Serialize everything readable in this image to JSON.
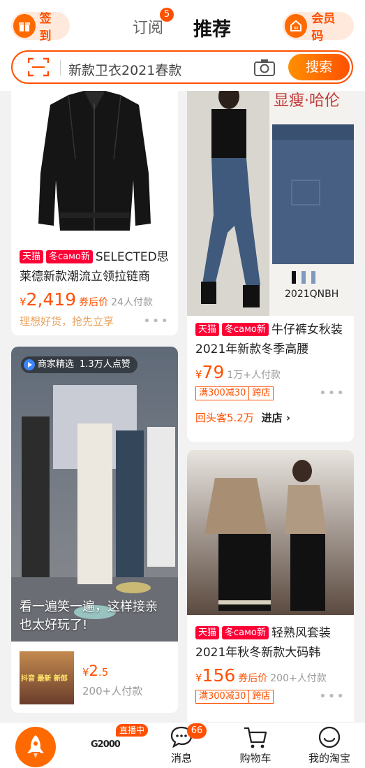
{
  "header": {
    "signin_label": "签到",
    "tab_subscribe": "订阅",
    "tab_subscribe_badge": "5",
    "tab_recommend": "推荐",
    "member_label": "会员码"
  },
  "search": {
    "query": "新款卫衣2021春款",
    "button_label": "搜索"
  },
  "feed": {
    "jacket": {
      "tag1": "天猫",
      "tag2": "冬само新",
      "title": "SELECTED思莱德新款潮流立领拉链商",
      "currency": "¥",
      "price": "2,419",
      "price_after": "券后价",
      "sold": "24人付款",
      "slogan": "理想好货，抢先立享"
    },
    "jeans": {
      "image_brand": "显瘦·哈伦",
      "image_sku": "2021QNBH",
      "tag1": "天猫",
      "tag2": "冬само新",
      "title": "牛仔裤女秋装2021年新款冬季高腰",
      "currency": "¥",
      "price": "79",
      "sold": "1万+人付款",
      "promo1": "满300减30",
      "promo2": "跨店",
      "repeat": "回头客5.2万",
      "enter_shop": "进店 ›"
    },
    "video": {
      "badge_label": "商家精选",
      "likes": "1.3万人点赞",
      "caption": "看一遍笑一遍，这样接亲也太好玩了!",
      "thumb_text": "抖音 最新 新郎",
      "currency": "¥",
      "price": "2",
      "price_decimal": ".5",
      "sold": "200+人付款"
    },
    "suit": {
      "tag1": "天猫",
      "tag2": "冬само新",
      "title": "轻熟风套装2021年秋冬新款大码韩",
      "currency": "¥",
      "price": "156",
      "price_after": "券后价",
      "sold": "200+人付款",
      "promo1": "满300减30",
      "promo2": "跨店"
    }
  },
  "bottom_nav": {
    "live_badge": "直播中",
    "live_logo": "G2000",
    "messages_label": "消息",
    "messages_badge": "66",
    "cart_label": "购物车",
    "me_label": "我的淘宝"
  },
  "colors": {
    "accent": "#ff5000",
    "tmall_red": "#ff0036"
  }
}
